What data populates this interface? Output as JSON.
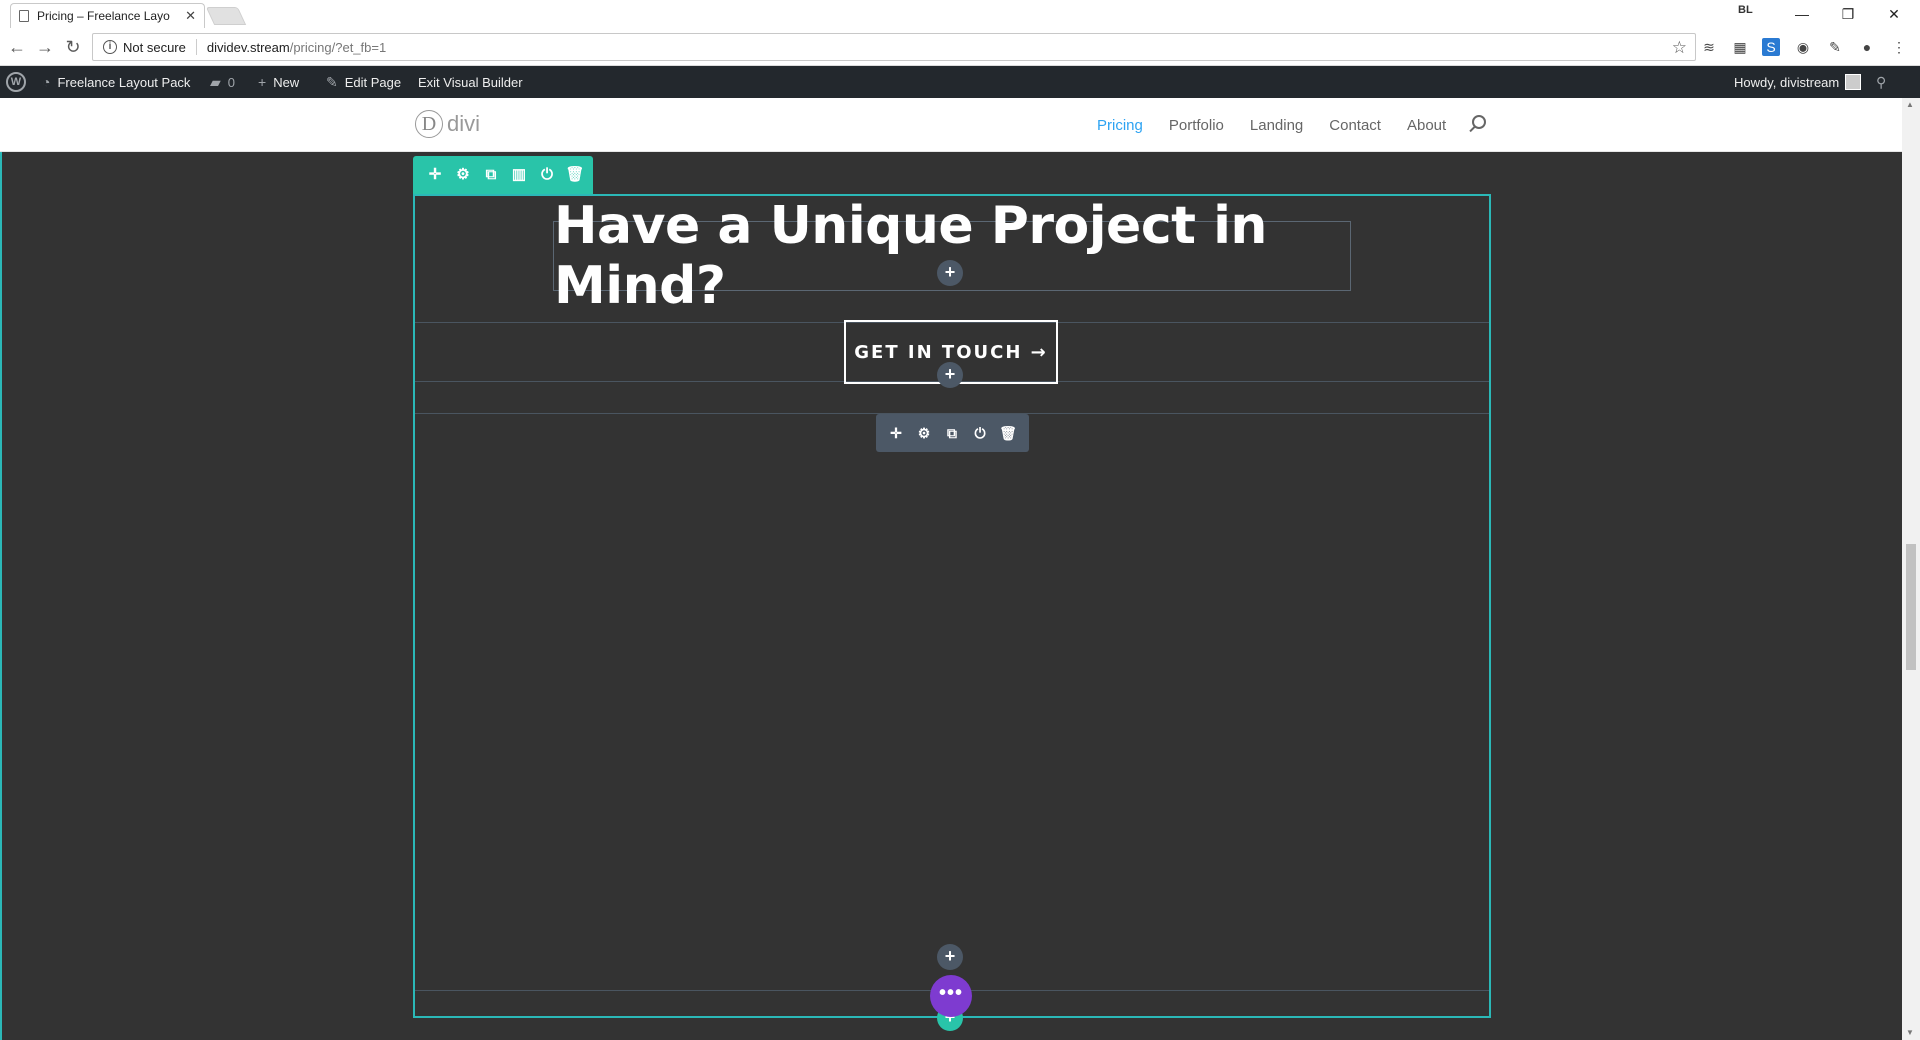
{
  "browser": {
    "tab_title": "Pricing – Freelance Layo",
    "tab_close": "✕",
    "url_host": "dividev.stream",
    "url_path": "/pricing/?et_fb=1",
    "security_label": "Not secure",
    "extension_badge": "BL"
  },
  "adminbar": {
    "site_name": "Freelance Layout Pack",
    "comments_count": "0",
    "new_label": "New",
    "edit_label": "Edit Page",
    "exit_label": "Exit Visual Builder",
    "greeting": "Howdy, divistream"
  },
  "site": {
    "logo_text": "divi",
    "logo_letter": "D",
    "menu": [
      {
        "label": "Pricing",
        "active": true
      },
      {
        "label": "Portfolio",
        "active": false
      },
      {
        "label": "Landing",
        "active": false
      },
      {
        "label": "Contact",
        "active": false
      },
      {
        "label": "About",
        "active": false
      }
    ]
  },
  "builder": {
    "heading": "Have a Unique Project in Mind?",
    "cta_label": "GET IN TOUCH →",
    "section_actions": [
      "move",
      "settings",
      "duplicate",
      "columns",
      "save",
      "delete"
    ],
    "row_actions": [
      "move",
      "settings",
      "duplicate",
      "save",
      "delete"
    ],
    "more_label": "•••"
  },
  "colors": {
    "accent_teal": "#29c4a9",
    "section_border": "#2bb8b7",
    "row_gray": "#4c5866",
    "builder_purple": "#7e3bd0",
    "menu_active": "#2ea3f2",
    "page_bg": "#333333"
  }
}
